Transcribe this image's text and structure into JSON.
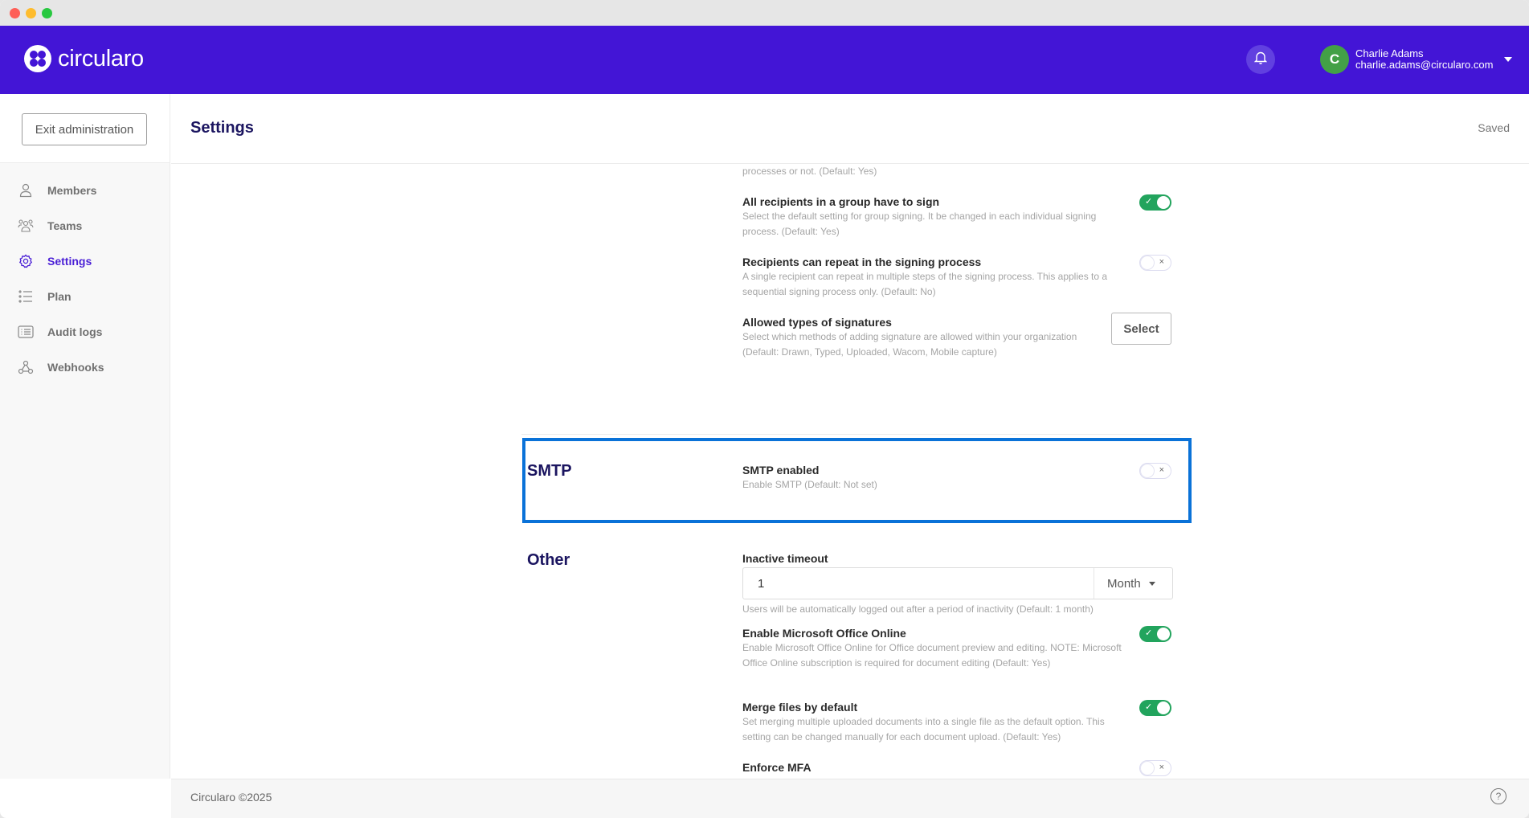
{
  "window": {
    "traffic_lights": [
      "close",
      "minimize",
      "zoom"
    ]
  },
  "appbar": {
    "brand": "circularo",
    "brand_color": "#4315d6",
    "notifications_icon": "bell-icon",
    "user": {
      "initial": "C",
      "name": "Charlie Adams",
      "email": "charlie.adams@circularo.com",
      "avatar_color": "#43a047"
    }
  },
  "sidebar": {
    "exit_label": "Exit administration",
    "items": [
      {
        "label": "Members",
        "icon": "user-icon",
        "active": false
      },
      {
        "label": "Teams",
        "icon": "users-group-icon",
        "active": false
      },
      {
        "label": "Settings",
        "icon": "gear-icon",
        "active": true
      },
      {
        "label": "Plan",
        "icon": "list-icon",
        "active": false
      },
      {
        "label": "Audit logs",
        "icon": "audit-log-icon",
        "active": false
      },
      {
        "label": "Webhooks",
        "icon": "webhook-icon",
        "active": false
      }
    ]
  },
  "header": {
    "title": "Settings",
    "status": "Saved"
  },
  "settings": {
    "partial_desc": "processes or not.  (Default: Yes)",
    "group_signing": {
      "title": "All recipients in a group have to sign",
      "desc": "Select the default setting for group signing. It be changed in each individual signing process.  (Default: Yes)",
      "enabled": true
    },
    "repeat_recipients": {
      "title": "Recipients can repeat in the signing process",
      "desc": "A single recipient can repeat in multiple steps of the signing process. This applies to a sequential signing process only.  (Default: No)",
      "enabled": false
    },
    "signature_types": {
      "title": "Allowed types of signatures",
      "desc": "Select which methods of adding signature are allowed within your organization  (Default: Drawn, Typed, Uploaded, Wacom, Mobile capture)",
      "button_label": "Select"
    },
    "smtp": {
      "section_title": "SMTP",
      "title": "SMTP enabled",
      "desc": "Enable SMTP  (Default: Not set)",
      "enabled": false
    },
    "other": {
      "section_title": "Other",
      "inactive_timeout": {
        "title": "Inactive timeout",
        "value": "1",
        "unit": "Month",
        "hint": "Users will be automatically logged out after a period of inactivity  (Default: 1 month)"
      },
      "office_online": {
        "title": "Enable Microsoft Office Online",
        "desc": "Enable Microsoft Office Online for Office document preview and editing. NOTE: Microsoft Office Online subscription is required for document editing  (Default: Yes)",
        "enabled": true
      },
      "merge_files": {
        "title": "Merge files by default",
        "desc": "Set merging multiple uploaded documents into a single file as the default option. This setting can be changed manually for each document upload.  (Default: Yes)",
        "enabled": true
      },
      "enforce_mfa": {
        "title": "Enforce MFA",
        "enabled": false
      }
    },
    "toggle_on_mark": "✓",
    "toggle_off_mark": "×"
  },
  "footer": {
    "copyright": "Circularo ©2025",
    "help_label": "?"
  }
}
